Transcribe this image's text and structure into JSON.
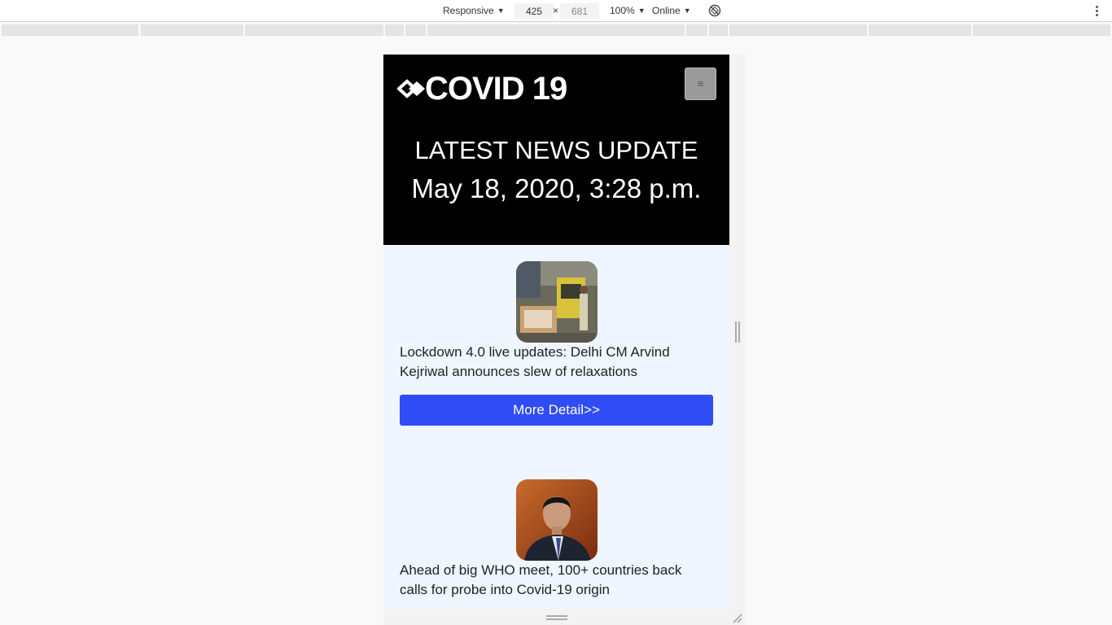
{
  "devtools": {
    "device_mode": "Responsive",
    "width": "425",
    "times": "×",
    "height": "681",
    "zoom": "100%",
    "network": "Online"
  },
  "site": {
    "brand": "COVID 19",
    "menu_icon": "≡",
    "headline": "LATEST NEWS UPDATE",
    "date": "May 18, 2020, 3:28 p.m.",
    "more_label": "More Detail>>",
    "news": [
      {
        "title": "Lockdown 4.0 live updates: Delhi CM Arvind Kejriwal announces slew of relaxations",
        "image": "lockdown-barricade-photo"
      },
      {
        "title": "Ahead of big WHO meet, 100+ countries back calls for probe into Covid-19 origin",
        "image": "xi-jinping-photo"
      }
    ]
  },
  "colors": {
    "header_bg": "#000000",
    "page_bg": "#eff6ff",
    "button_bg": "#2f4cf5"
  }
}
